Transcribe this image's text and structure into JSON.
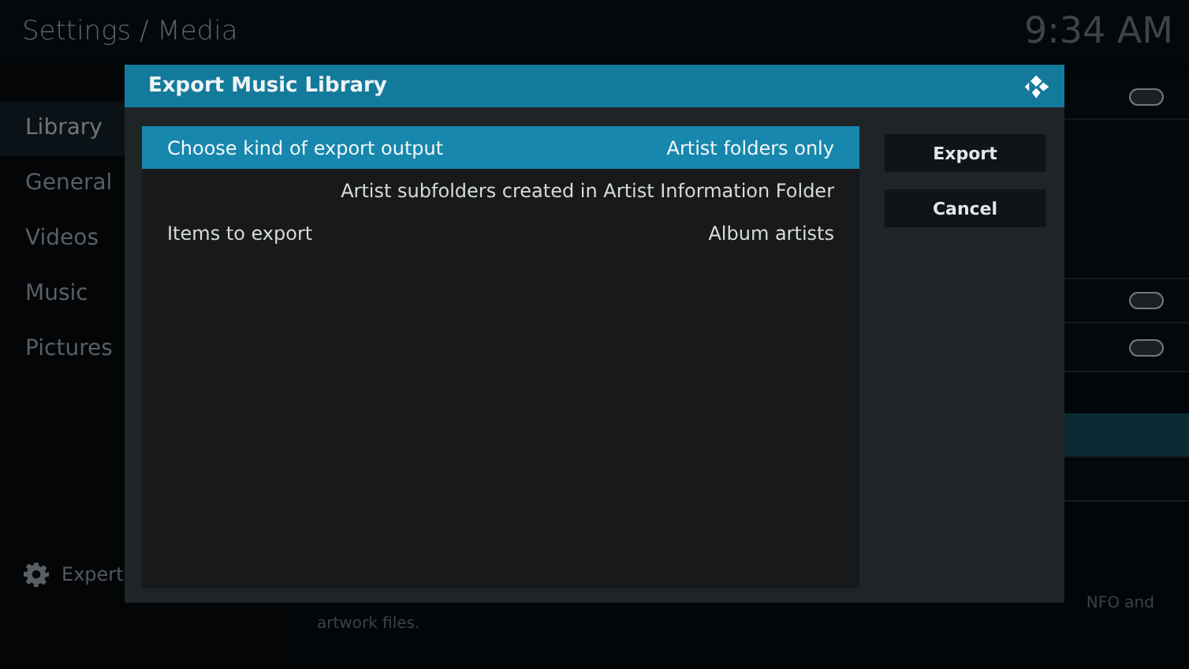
{
  "header": {
    "title": "Settings / Media",
    "clock": "9:34 AM"
  },
  "sidebar": {
    "items": [
      {
        "label": "Library",
        "selected": true
      },
      {
        "label": "General",
        "selected": false
      },
      {
        "label": "Videos",
        "selected": false
      },
      {
        "label": "Music",
        "selected": false
      },
      {
        "label": "Pictures",
        "selected": false
      }
    ],
    "level_button": {
      "label": "Expert"
    }
  },
  "settings_rows": [
    {
      "kind": "toggle",
      "on": false,
      "selected": false
    },
    {
      "kind": "blank",
      "selected": false
    },
    {
      "kind": "toggle",
      "on": false,
      "selected": false
    },
    {
      "kind": "toggle",
      "on": false,
      "selected": false
    },
    {
      "kind": "blank",
      "selected": true
    },
    {
      "kind": "blank",
      "selected": false
    }
  ],
  "description": [
    "NFO and",
    "artwork files."
  ],
  "dialog": {
    "title": "Export Music Library",
    "options": [
      {
        "label": "Choose kind of export output",
        "value": "Artist folders only",
        "selected": true
      },
      {
        "value": "Artist subfolders created in Artist Information Folder",
        "selected": false
      },
      {
        "label": "Items to export",
        "value": "Album artists",
        "selected": false
      }
    ],
    "buttons": [
      "Export",
      "Cancel"
    ]
  }
}
